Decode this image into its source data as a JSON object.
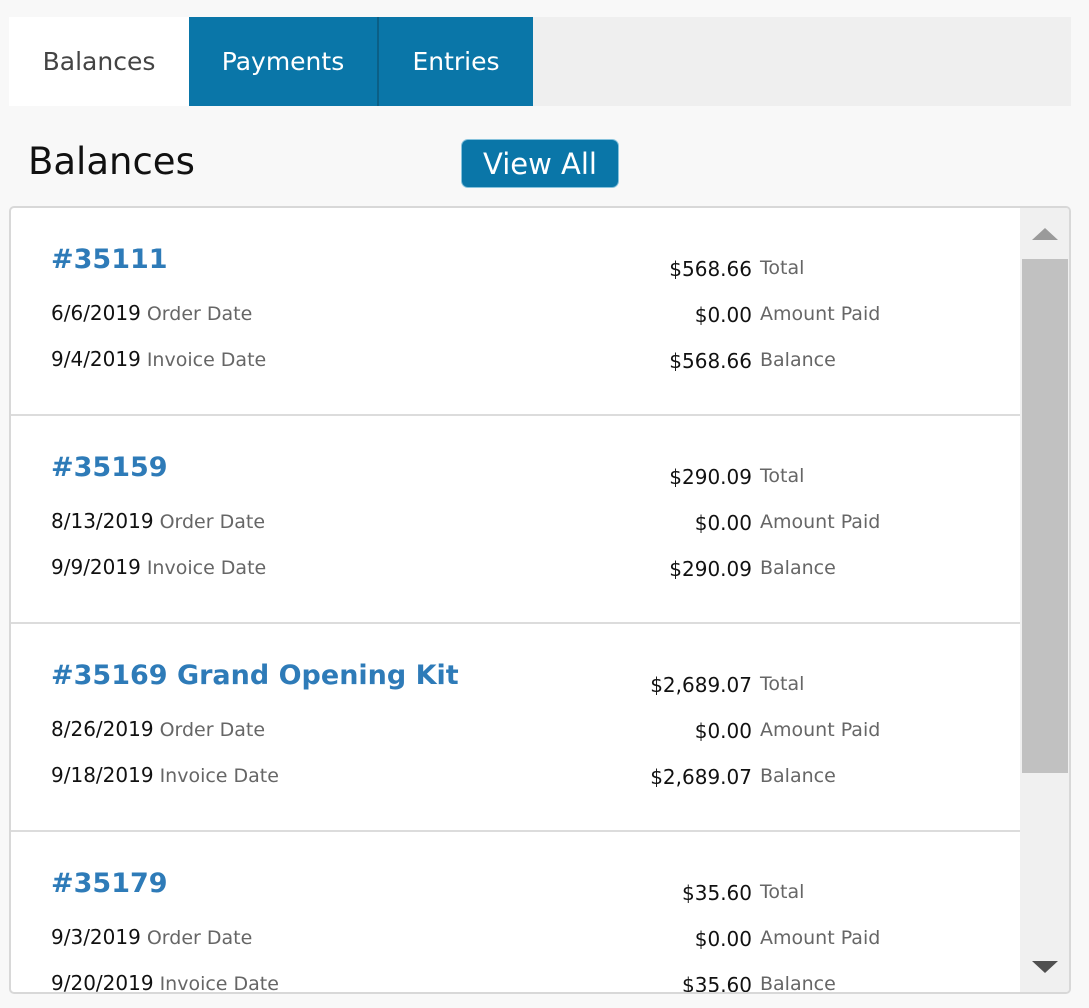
{
  "tabs": [
    {
      "label": "Balances",
      "active": true
    },
    {
      "label": "Payments",
      "active": false
    },
    {
      "label": "Entries",
      "active": false
    }
  ],
  "section": {
    "title": "Balances",
    "view_all_label": "View All"
  },
  "labels": {
    "order_date": "Order Date",
    "invoice_date": "Invoice Date",
    "total": "Total",
    "amount_paid": "Amount Paid",
    "balance": "Balance"
  },
  "balances": [
    {
      "title": "#35111",
      "order_date": "6/6/2019",
      "invoice_date": "9/4/2019",
      "total": "$568.66",
      "amount_paid": "$0.00",
      "balance": "$568.66"
    },
    {
      "title": "#35159",
      "order_date": "8/13/2019",
      "invoice_date": "9/9/2019",
      "total": "$290.09",
      "amount_paid": "$0.00",
      "balance": "$290.09"
    },
    {
      "title": "#35169 Grand Opening Kit",
      "order_date": "8/26/2019",
      "invoice_date": "9/18/2019",
      "total": "$2,689.07",
      "amount_paid": "$0.00",
      "balance": "$2,689.07"
    },
    {
      "title": "#35179",
      "order_date": "9/3/2019",
      "invoice_date": "9/20/2019",
      "total": "$35.60",
      "amount_paid": "$0.00",
      "balance": "$35.60"
    }
  ],
  "colors": {
    "accent": "#0a76a8",
    "link": "#2e7bb8"
  }
}
